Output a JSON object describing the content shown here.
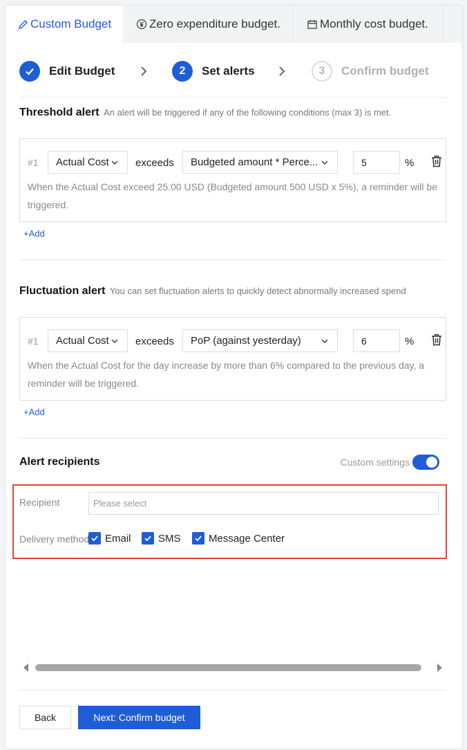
{
  "tabs": [
    {
      "label": "Custom Budget",
      "icon": "pencil-icon"
    },
    {
      "label": "Zero expenditure budget.",
      "icon": "yen-circle-icon"
    },
    {
      "label": "Monthly cost budget.",
      "icon": "calendar-icon"
    }
  ],
  "steps": [
    {
      "number": "1",
      "label": "Edit Budget",
      "state": "done"
    },
    {
      "number": "2",
      "label": "Set alerts",
      "state": "current"
    },
    {
      "number": "3",
      "label": "Confirm budget",
      "state": "todo"
    }
  ],
  "threshold": {
    "title": "Threshold alert",
    "subtitle": "An alert will be triggered if any of the following conditions (max 3) is met.",
    "rule": {
      "index": "#1",
      "metric": "Actual Cost",
      "operator": "exceeds",
      "basis": "Budgeted amount * Perce...",
      "value": "5",
      "unit": "%",
      "description": "When the Actual Cost exceed 25.00 USD (Budgeted amount 500 USD x 5%), a reminder will be triggered."
    },
    "add_label": "+Add"
  },
  "fluctuation": {
    "title": "Fluctuation alert",
    "subtitle": "You can set fluctuation alerts to quickly detect abnormally increased spend",
    "rule": {
      "index": "#1",
      "metric": "Actual Cost",
      "operator": "exceeds",
      "basis": "PoP (against yesterday)",
      "value": "6",
      "unit": "%",
      "description": "When the Actual Cost for the day increase by more than 6% compared to the previous day, a reminder will be triggered."
    },
    "add_label": "+Add"
  },
  "recipients": {
    "title": "Alert recipients",
    "custom_settings_label": "Custom settings",
    "custom_settings_on": true,
    "recipient_label": "Recipient",
    "recipient_placeholder": "Please select",
    "delivery_label": "Delivery method",
    "methods": [
      {
        "label": "Email",
        "checked": true
      },
      {
        "label": "SMS",
        "checked": true
      },
      {
        "label": "Message Center",
        "checked": true
      }
    ]
  },
  "footer": {
    "back_label": "Back",
    "next_label": "Next: Confirm budget"
  },
  "colors": {
    "accent": "#1f5dd6",
    "highlight_border": "#e0453a"
  }
}
